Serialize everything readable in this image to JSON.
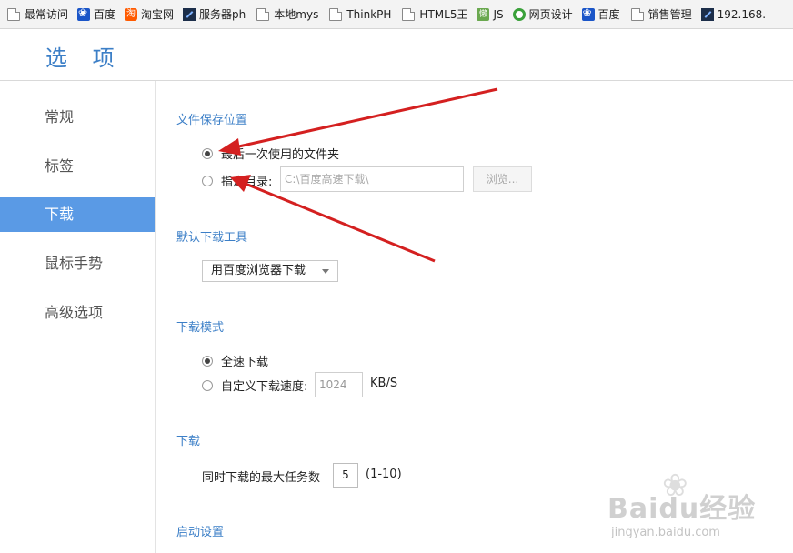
{
  "bookmarks": [
    {
      "label": "最常访问",
      "icon": "page-icon"
    },
    {
      "label": "百度",
      "icon": "baidu-paw-icon"
    },
    {
      "label": "淘宝网",
      "icon": "taobao-icon"
    },
    {
      "label": "服务器ph",
      "icon": "zend-icon"
    },
    {
      "label": "本地mys",
      "icon": "page-icon"
    },
    {
      "label": "ThinkPH",
      "icon": "page-icon"
    },
    {
      "label": "HTML5王",
      "icon": "page-icon"
    },
    {
      "label": "JS",
      "icon": "lazy-icon"
    },
    {
      "label": "网页设计",
      "icon": "leaf-icon"
    },
    {
      "label": "百度",
      "icon": "baidu-paw-icon"
    },
    {
      "label": "销售管理",
      "icon": "page-icon"
    },
    {
      "label": "192.168.",
      "icon": "zend-icon"
    }
  ],
  "page": {
    "title": "选 项"
  },
  "sidebar": {
    "items": [
      {
        "label": "常规",
        "active": false
      },
      {
        "label": "标签",
        "active": false
      },
      {
        "label": "下载",
        "active": true
      },
      {
        "label": "鼠标手势",
        "active": false
      },
      {
        "label": "高级选项",
        "active": false
      }
    ]
  },
  "file_save": {
    "title": "文件保存位置",
    "option_last": "最后一次使用的文件夹",
    "option_dir": "指定目录:",
    "dir_placeholder": "C:\\百度高速下载\\",
    "browse_label": "浏览..."
  },
  "default_tool": {
    "title": "默认下载工具",
    "selected": "用百度浏览器下载"
  },
  "download_mode": {
    "title": "下载模式",
    "option_full": "全速下载",
    "option_custom": "自定义下载速度:",
    "speed_value": "1024",
    "speed_unit": "KB/S"
  },
  "download": {
    "title": "下载",
    "max_tasks_label": "同时下载的最大任务数",
    "max_tasks_value": "5",
    "range": "(1-10)"
  },
  "startup": {
    "title": "启动设置"
  },
  "watermark": {
    "logo": "Baidu经验",
    "url": "jingyan.baidu.com"
  },
  "colors": {
    "accent": "#5a9ae5",
    "title": "#3c7fc7",
    "arrow": "#d42020"
  }
}
